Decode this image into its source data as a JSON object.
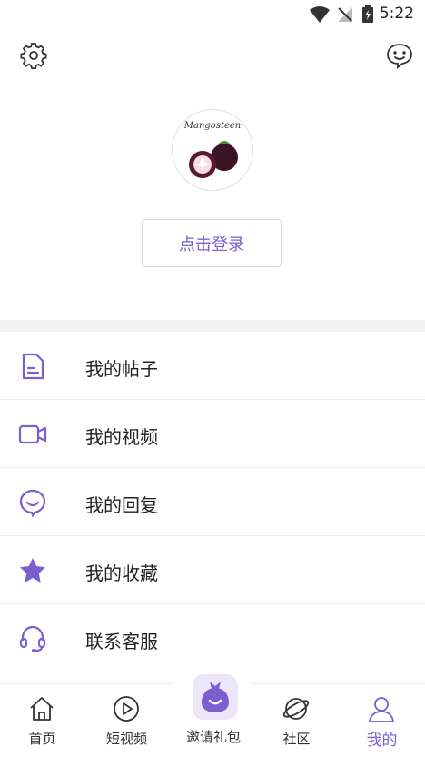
{
  "status_bar": {
    "time": "5:22"
  },
  "profile": {
    "avatar_logo_text": "Mangosteen",
    "login_label": "点击登录"
  },
  "menu": {
    "items": [
      {
        "label": "我的帖子",
        "icon": "document-icon"
      },
      {
        "label": "我的视频",
        "icon": "video-camera-icon"
      },
      {
        "label": "我的回复",
        "icon": "smile-chat-icon"
      },
      {
        "label": "我的收藏",
        "icon": "star-icon"
      },
      {
        "label": "联系客服",
        "icon": "headset-icon"
      }
    ]
  },
  "tabbar": {
    "tabs": [
      {
        "label": "首页",
        "icon": "home-icon"
      },
      {
        "label": "短视频",
        "icon": "play-circle-icon"
      },
      {
        "label": "邀请礼包",
        "icon": "gift-bag-icon"
      },
      {
        "label": "社区",
        "icon": "planet-icon"
      },
      {
        "label": "我的",
        "icon": "user-icon",
        "active": true
      }
    ]
  },
  "colors": {
    "accent": "#7b5fd1",
    "menu_icon": "#7b5fd1",
    "divider": "#f2f2f2"
  }
}
